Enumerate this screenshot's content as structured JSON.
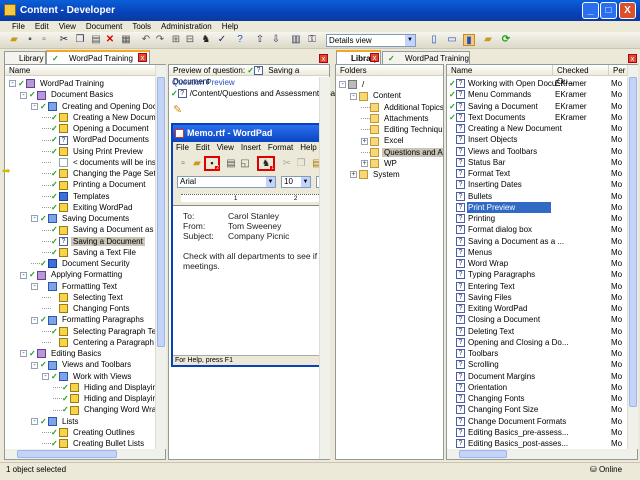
{
  "window": {
    "title": "Content - Developer",
    "minimize": "_",
    "maximize": "□",
    "close": "X"
  },
  "menu": [
    "File",
    "Edit",
    "View",
    "Document",
    "Tools",
    "Administration",
    "Help"
  ],
  "toolbar": {
    "view_select": "Details view"
  },
  "left_pane": {
    "tabs": [
      {
        "label": "Library"
      },
      {
        "label": "WordPad Training",
        "active": true
      }
    ],
    "close": "x",
    "tree_header": "Name",
    "tree": [
      {
        "level": 0,
        "label": "WordPad Training",
        "icon": "book",
        "check": true,
        "exp": "-"
      },
      {
        "level": 1,
        "label": "Document Basics",
        "icon": "book",
        "check": true,
        "exp": "-"
      },
      {
        "level": 2,
        "label": "Creating and Opening Documer",
        "icon": "bbook",
        "check": true,
        "exp": "-"
      },
      {
        "level": 3,
        "label": "Creating a New Document",
        "icon": "qy",
        "check": true
      },
      {
        "level": 3,
        "label": "Opening a Document",
        "icon": "qy",
        "check": true
      },
      {
        "level": 3,
        "label": "WordPad Documents",
        "icon": "q",
        "check": true
      },
      {
        "level": 3,
        "label": "Using Print Preview",
        "icon": "qy",
        "check": true
      },
      {
        "level": 3,
        "label": "< documents will be inserte",
        "icon": "doc",
        "check": false,
        "pointer": true
      },
      {
        "level": 3,
        "label": "Changing the Page Setup",
        "icon": "qy",
        "check": true
      },
      {
        "level": 3,
        "label": "Printing a Document",
        "icon": "qy",
        "check": true
      },
      {
        "level": 3,
        "label": "Templates",
        "icon": "bdoc",
        "check": true
      },
      {
        "level": 3,
        "label": "Exiting WordPad",
        "icon": "qy",
        "check": true
      },
      {
        "level": 2,
        "label": "Saving Documents",
        "icon": "bbook",
        "check": true,
        "exp": "-"
      },
      {
        "level": 3,
        "label": "Saving a Document as a Ne",
        "icon": "qy",
        "check": true
      },
      {
        "level": 3,
        "label": "Saving a Document",
        "icon": "q",
        "check": true,
        "selected": true
      },
      {
        "level": 3,
        "label": "Saving a Text File",
        "icon": "qy",
        "check": true
      },
      {
        "level": 2,
        "label": "Document Security",
        "icon": "bdoc",
        "check": true
      },
      {
        "level": 1,
        "label": "Applying Formatting",
        "icon": "book",
        "check": true,
        "exp": "-"
      },
      {
        "level": 2,
        "label": "Formatting Text",
        "icon": "bbook",
        "check": false,
        "exp": "-"
      },
      {
        "level": 3,
        "label": "Selecting Text",
        "icon": "qy",
        "check": false
      },
      {
        "level": 3,
        "label": "Changing Fonts",
        "icon": "qy",
        "check": false
      },
      {
        "level": 2,
        "label": "Formatting Paragraphs",
        "icon": "bbook",
        "check": true,
        "exp": "-"
      },
      {
        "level": 3,
        "label": "Selecting Paragraph Text",
        "icon": "qy",
        "check": true
      },
      {
        "level": 3,
        "label": "Centering a Paragraph",
        "icon": "qy",
        "check": false
      },
      {
        "level": 1,
        "label": "Editing Basics",
        "icon": "book",
        "check": true,
        "exp": "-"
      },
      {
        "level": 2,
        "label": "Views and Toolbars",
        "icon": "bbook",
        "check": true,
        "exp": "-"
      },
      {
        "level": 3,
        "label": "Work with Views",
        "icon": "bbook",
        "check": true,
        "exp": "-"
      },
      {
        "level": 4,
        "label": "Hiding and Displaying th",
        "icon": "qy",
        "check": true
      },
      {
        "level": 4,
        "label": "Hiding and Displaying th",
        "icon": "qy",
        "check": true
      },
      {
        "level": 4,
        "label": "Changing Word Wrap O",
        "icon": "qy",
        "check": true
      },
      {
        "level": 2,
        "label": "Lists",
        "icon": "bbook",
        "check": true,
        "exp": "-"
      },
      {
        "level": 3,
        "label": "Creating Outlines",
        "icon": "qy",
        "check": true
      },
      {
        "level": 3,
        "label": "Creating Bullet Lists",
        "icon": "qy",
        "check": true
      }
    ],
    "preview": {
      "header_label": "Preview of question:",
      "header_item": "Saving a Document",
      "group_title": "Question Preview",
      "path": "/Content/Questions and Assessments/Sa...",
      "wordpad": {
        "title": "Memo.rtf - WordPad",
        "menu": [
          "File",
          "Edit",
          "View",
          "Insert",
          "Format",
          "Help"
        ],
        "font": "Arial",
        "size": "10",
        "ruler_marks": [
          "1",
          "2"
        ],
        "doc": {
          "to_label": "To:",
          "to": "Carol Stanley",
          "from_label": "From:",
          "from": "Tom Sweeney",
          "subject_label": "Subject:",
          "subject": "Company Picnic",
          "body1": "Check with all departments to see if the",
          "body2": "meetings."
        },
        "status": "For Help, press F1",
        "highlight_badges": [
          "2",
          "1"
        ]
      }
    }
  },
  "right_pane": {
    "tabs": [
      {
        "label": "Library",
        "active": true
      },
      {
        "label": "WordPad Training"
      }
    ],
    "close": "x",
    "folders_header": "Folders",
    "folders": [
      {
        "level": 0,
        "label": "/",
        "exp": "-",
        "icon": "drive"
      },
      {
        "level": 1,
        "label": "Content",
        "exp": "-"
      },
      {
        "level": 2,
        "label": "Additional Topics"
      },
      {
        "level": 2,
        "label": "Attachments"
      },
      {
        "level": 2,
        "label": "Editing Techniques"
      },
      {
        "level": 2,
        "label": "Excel",
        "exp": "+"
      },
      {
        "level": 2,
        "label": "Questions and Asses",
        "selected": true
      },
      {
        "level": 2,
        "label": "WP",
        "exp": "+"
      },
      {
        "level": 1,
        "label": "System",
        "exp": "+"
      }
    ],
    "columns": [
      "Name",
      "Checked Ou...",
      "Per"
    ],
    "items": [
      {
        "name": "Working with Open Docu...",
        "checked_out": "EKramer",
        "check": true,
        "per": "Mo"
      },
      {
        "name": "Menu Commands",
        "checked_out": "EKramer",
        "check": true,
        "per": "Mo"
      },
      {
        "name": "Saving a Document",
        "checked_out": "EKramer",
        "check": true,
        "per": "Mo"
      },
      {
        "name": "Text Documents",
        "checked_out": "EKramer",
        "check": true,
        "per": "Mo"
      },
      {
        "name": "Creating a New Document",
        "per": "Mo"
      },
      {
        "name": "Insert Objects",
        "per": "Mo"
      },
      {
        "name": "Views and Toolbars",
        "per": "Mo"
      },
      {
        "name": "Status Bar",
        "per": "Mo"
      },
      {
        "name": "Format Text",
        "per": "Mo"
      },
      {
        "name": "Inserting Dates",
        "per": "Mo"
      },
      {
        "name": "Bullets",
        "per": "Mo"
      },
      {
        "name": "Print Preview",
        "per": "Mo",
        "selected": true
      },
      {
        "name": "Printing",
        "per": "Mo"
      },
      {
        "name": "Format dialog box",
        "per": "Mo"
      },
      {
        "name": "Saving a Document as a ...",
        "per": "Mo"
      },
      {
        "name": "Menus",
        "per": "Mo"
      },
      {
        "name": "Word Wrap",
        "per": "Mo"
      },
      {
        "name": "Typing Paragraphs",
        "per": "Mo"
      },
      {
        "name": "Entering Text",
        "per": "Mo"
      },
      {
        "name": "Saving Files",
        "per": "Mo"
      },
      {
        "name": "Exiting WordPad",
        "per": "Mo"
      },
      {
        "name": "Closing a Document",
        "per": "Mo"
      },
      {
        "name": "Deleting Text",
        "per": "Mo"
      },
      {
        "name": "Opening and Closing a Do...",
        "per": "Mo"
      },
      {
        "name": "Toolbars",
        "per": "Mo"
      },
      {
        "name": "Scrolling",
        "per": "Mo"
      },
      {
        "name": "Document Margins",
        "per": "Mo"
      },
      {
        "name": "Orientation",
        "per": "Mo"
      },
      {
        "name": "Changing Fonts",
        "per": "Mo"
      },
      {
        "name": "Changing Font Size",
        "per": "Mo"
      },
      {
        "name": "Change Document Formats",
        "per": "Mo"
      },
      {
        "name": "Editing Basics_pre-assess...",
        "per": "Mo",
        "assess": true
      },
      {
        "name": "Editing Basics_post-asses...",
        "per": "Mo",
        "assess": true
      }
    ]
  },
  "status": {
    "left": "1 object selected",
    "right": "Online"
  },
  "colors": {
    "title_bar": "#0842b8",
    "selection": "#316ac5",
    "tab_accent": "#f5a623",
    "check": "#1aa01a",
    "highlight": "#e00000"
  }
}
